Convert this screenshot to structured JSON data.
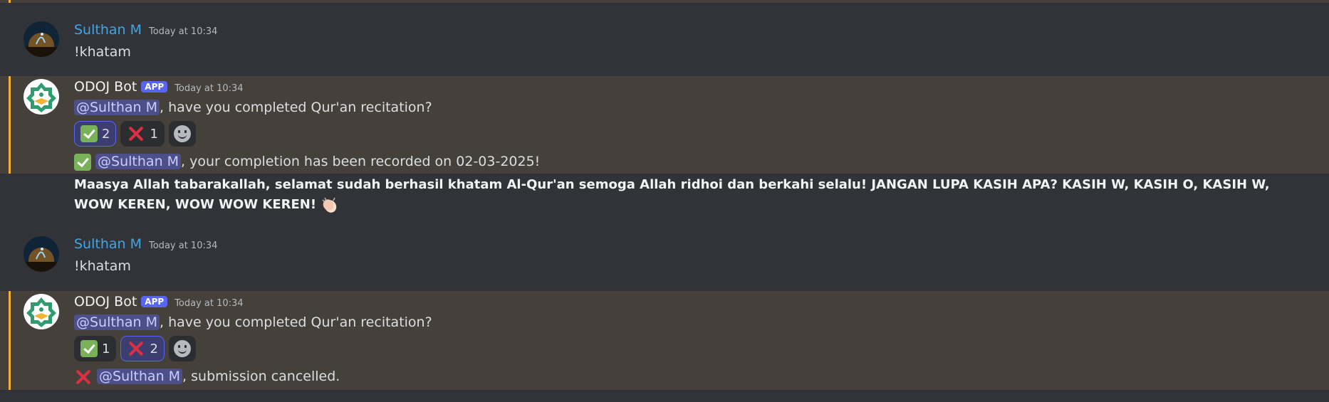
{
  "messages": [
    {
      "author": "Sulthan M",
      "timestamp": "Today at 10:34",
      "text": "!khatam",
      "avatar_icon": "night-landscape-avatar"
    },
    {
      "author": "ODOJ Bot",
      "badge": "APP",
      "timestamp": "Today at 10:34",
      "mention": "@Sulthan M",
      "text": ", have you completed Qur'an recitation?",
      "reactions": [
        {
          "emoji": "check-mark-button",
          "count": "2",
          "active": true
        },
        {
          "emoji": "cross-mark",
          "count": "1",
          "active": false
        }
      ],
      "followup_mention": "@Sulthan M",
      "followup_text": ", your completion has been recorded on 02-03-2025!",
      "congrats": "Maasya Allah tabarakallah, selamat sudah berhasil khatam Al-Qur'an semoga Allah ridhoi dan berkahi selalu! JANGAN LUPA KASIH APA? KASIH W, KASIH O, KASIH W, WOW KEREN, WOW WOW KEREN!",
      "avatar_icon": "quran-bot-avatar"
    },
    {
      "author": "Sulthan M",
      "timestamp": "Today at 10:34",
      "text": "!khatam",
      "avatar_icon": "night-landscape-avatar"
    },
    {
      "author": "ODOJ Bot",
      "badge": "APP",
      "timestamp": "Today at 10:34",
      "mention": "@Sulthan M",
      "text": ", have you completed Qur'an recitation?",
      "reactions": [
        {
          "emoji": "check-mark-button",
          "count": "1",
          "active": false
        },
        {
          "emoji": "cross-mark",
          "count": "2",
          "active": true
        }
      ],
      "followup_mention": "@Sulthan M",
      "followup_text": ", submission cancelled.",
      "avatar_icon": "quran-bot-avatar"
    }
  ],
  "colors": {
    "background": "#313338",
    "highlight": "#45413a",
    "accent": "#f0b232",
    "username": "#3ea6e6",
    "badge": "#5865f2"
  }
}
